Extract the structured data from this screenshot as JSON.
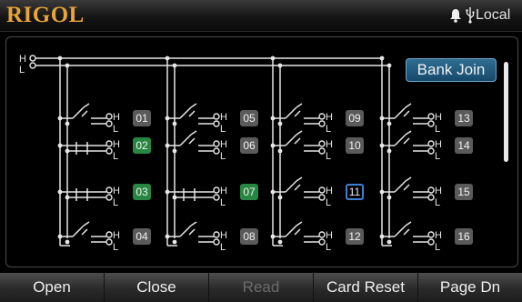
{
  "header": {
    "brand": "RIGOL",
    "status_icons": [
      "bell-icon",
      "usb-icon"
    ],
    "mode": "Local"
  },
  "matrix": {
    "rail_labels": {
      "high": "H",
      "low": "L"
    },
    "terminal_high": "H",
    "terminal_low": "L",
    "bank_join_label": "Bank Join",
    "channels": [
      {
        "id": "01",
        "state": "open"
      },
      {
        "id": "02",
        "state": "closed"
      },
      {
        "id": "03",
        "state": "closed"
      },
      {
        "id": "04",
        "state": "open"
      },
      {
        "id": "05",
        "state": "open"
      },
      {
        "id": "06",
        "state": "open"
      },
      {
        "id": "07",
        "state": "closed"
      },
      {
        "id": "08",
        "state": "open"
      },
      {
        "id": "09",
        "state": "open"
      },
      {
        "id": "10",
        "state": "open"
      },
      {
        "id": "11",
        "state": "selected"
      },
      {
        "id": "12",
        "state": "open"
      },
      {
        "id": "13",
        "state": "open"
      },
      {
        "id": "14",
        "state": "open"
      },
      {
        "id": "15",
        "state": "open"
      },
      {
        "id": "16",
        "state": "open"
      }
    ],
    "colors": {
      "closed": "#27863f",
      "open": "#5a5a5a",
      "selected": "#3e7fd6",
      "wire": "#e6e6e6"
    }
  },
  "softkeys": [
    {
      "label": "Open",
      "enabled": true
    },
    {
      "label": "Close",
      "enabled": true
    },
    {
      "label": "Read",
      "enabled": false
    },
    {
      "label": "Card Reset",
      "enabled": true
    },
    {
      "label": "Page Dn",
      "enabled": true
    }
  ]
}
